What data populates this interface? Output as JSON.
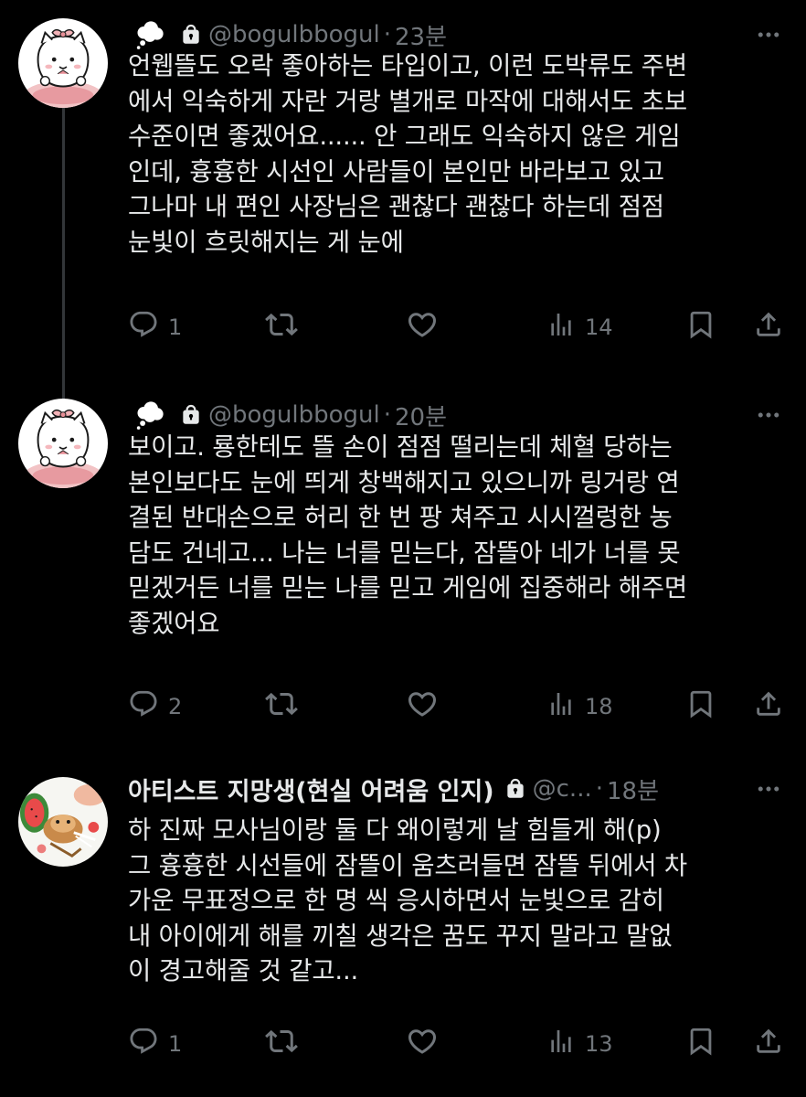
{
  "colors": {
    "background": "#000000",
    "text_primary": "#e7e9ea",
    "text_secondary": "#71767b",
    "thread_line": "#333639"
  },
  "tweets": [
    {
      "display_name": "",
      "name_icon": "thought-bubble-icon",
      "protected_icon": "lock-icon",
      "handle": "@bogulbbogul",
      "separator": "·",
      "time": "23분",
      "text": "언웹뜰도 오락 좋아하는 타입이고, 이런 도박류도 주변\n에서 익숙하게 자란 거랑 별개로 마작에 대해서도 초보\n수준이면 좋겠어요...... 안 그래도 익숙하지 않은 게임\n인데, 흉흉한 시선인 사람들이 본인만 바라보고 있고\n그나마 내 편인 사장님은 괜찮다 괜찮다 하는데 점점\n눈빛이 흐릿해지는 게 눈에",
      "replies": "1",
      "retweets": "",
      "likes": "",
      "views": "14"
    },
    {
      "display_name": "",
      "name_icon": "thought-bubble-icon",
      "protected_icon": "lock-icon",
      "handle": "@bogulbbogul",
      "separator": "·",
      "time": "20분",
      "text": "보이고. 룡한테도 뜰 손이 점점 떨리는데 체혈 당하는\n본인보다도 눈에 띄게 창백해지고 있으니까 링거랑 연\n결된 반대손으로 허리 한 번 팡 쳐주고 시시껄렁한 농\n담도 건네고... 나는 너를 믿는다, 잠뜰아 네가 너를 못\n믿겠거든 너를 믿는 나를 믿고 게임에 집중해라 해주면\n좋겠어요",
      "replies": "2",
      "retweets": "",
      "likes": "",
      "views": "18"
    },
    {
      "display_name": "아티스트 지망생(현실 어려움 인지)",
      "name_icon": "",
      "protected_icon": "lock-icon",
      "handle": "@c...",
      "separator": "·",
      "time": "18분",
      "text": "하 진짜 모사님이랑 둘 다 왜이렇게 날 힘들게 해(p)\n그 흉흉한 시선들에 잠뜰이 움츠러들면 잠뜰 뒤에서 차\n가운 무표정으로 한 명 씩 응시하면서 눈빛으로 감히\n내 아이에게 해를 끼칠 생각은 꿈도 꾸지 말라고 말없\n이 경고해줄 것 같고...",
      "replies": "1",
      "retweets": "",
      "likes": "",
      "views": "13"
    }
  ]
}
